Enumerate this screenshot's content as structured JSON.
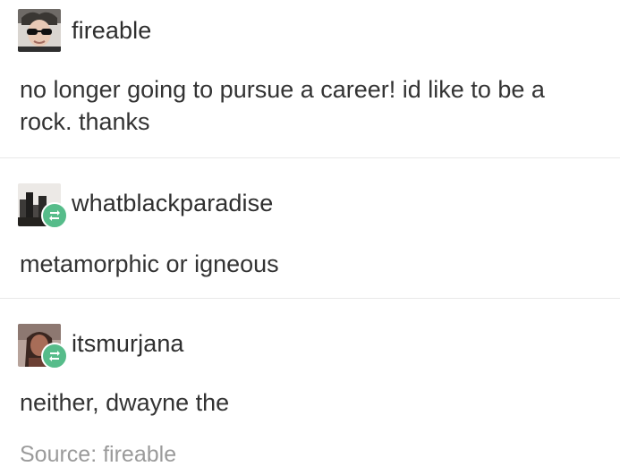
{
  "posts": [
    {
      "username": "fireable",
      "text": "no longer going to pursue a career! id like to be a rock. thanks",
      "reblog": false
    },
    {
      "username": "whatblackparadise",
      "text": "metamorphic or igneous",
      "reblog": true
    },
    {
      "username": "itsmurjana",
      "text": "neither, dwayne the",
      "reblog": true
    }
  ],
  "source": {
    "text": "Source: fireable"
  },
  "colors": {
    "reblog_badge": "#56bc8a",
    "divider": "#e9e9e9",
    "source_text": "#9a9a9a"
  },
  "icons": {
    "reblog": "reblog-icon",
    "avatar_1": "avatar-sunglasses-portrait",
    "avatar_2": "avatar-dark-cityscape",
    "avatar_3": "avatar-woman-portrait"
  }
}
